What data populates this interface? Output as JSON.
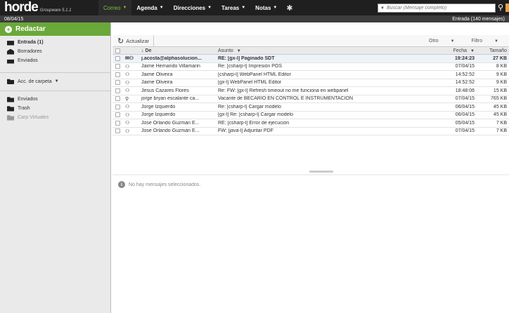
{
  "app": {
    "logo": "horde",
    "logo_sub": "Groupware 5.1.1"
  },
  "menu": [
    {
      "label": "Correo"
    },
    {
      "label": "Agenda"
    },
    {
      "label": "Direcciones"
    },
    {
      "label": "Tareas"
    },
    {
      "label": "Notas"
    }
  ],
  "search": {
    "placeholder": "Buscar (Mensaje completo)"
  },
  "subbar": {
    "date": "08/04/15",
    "mailbox_status": "Entrada (140 mensajes)"
  },
  "sidebar": {
    "compose_label": "Redactar",
    "folders": [
      {
        "label": "Entrada (1)"
      },
      {
        "label": "Borradores"
      },
      {
        "label": "Enviados"
      }
    ],
    "folder_actions_label": "Acc. de carpeta",
    "local_folders": [
      {
        "label": "Enviados"
      },
      {
        "label": "Trash"
      },
      {
        "label": "Carp Virtuales"
      }
    ]
  },
  "toolbar": {
    "refresh_label": "Actualizar",
    "other_label": "Otro",
    "filter_label": "Filtro"
  },
  "columns": {
    "from": "De",
    "subject": "Asunto",
    "date": "Fecha",
    "size": "Tamaño"
  },
  "messages": [
    {
      "icons": "✉ ⚇",
      "from": "j.acosta@alphasolucion...",
      "subject": "RE: [gx-l] Paginado SDT",
      "date": "19:24:23",
      "size": "27 KB",
      "unread": true
    },
    {
      "icons": "⚇",
      "from": "Jaime Hernando Villamarin",
      "subject": "Re: [csharp-l] Impresión POS",
      "date": "07/04/15",
      "size": "8 KB",
      "unread": false
    },
    {
      "icons": "⚇",
      "from": "Jaime Oliveira",
      "subject": "[csharp-l] WebPanel HTML Editor",
      "date": "14:52:52",
      "size": "9 KB",
      "unread": false
    },
    {
      "icons": "⚇",
      "from": "Jaime Oliveira",
      "subject": "[gx-l] WebPanel HTML Editor",
      "date": "14:52:52",
      "size": "9 KB",
      "unread": false
    },
    {
      "icons": "⚇",
      "from": "Jesus Cazares Flores",
      "subject": "Re: FW: [gx-l] Refresh timeout no me funciona en webpanel",
      "date": "18:48:06",
      "size": "15 KB",
      "unread": false
    },
    {
      "icons": "⚲",
      "from": "jorge bryan escalante ca...",
      "subject": "Vacante de BECARIO EN CONTROL E INSTRUMENTACIÓN",
      "date": "07/04/15",
      "size": "765 KB",
      "unread": false
    },
    {
      "icons": "⚇",
      "from": "Jorge Izquierdo",
      "subject": "Re: [csharp-l] Cargar modelo",
      "date": "06/04/15",
      "size": "45 KB",
      "unread": false
    },
    {
      "icons": "⚇",
      "from": "Jorge Izquierdo",
      "subject": "[gx-l] Re: [csharp-l] Cargar modelo",
      "date": "06/04/15",
      "size": "45 KB",
      "unread": false
    },
    {
      "icons": "⚇",
      "from": "Jose Orlando Guzmán E...",
      "subject": "RE: [csharp-l] Error de ejecución",
      "date": "05/04/15",
      "size": "7 KB",
      "unread": false
    },
    {
      "icons": "⚇",
      "from": "Jose Orlando Guzmán E...",
      "subject": "FW: [java-l] Adjuntar PDF",
      "date": "07/04/15",
      "size": "7 KB",
      "unread": false
    }
  ],
  "preview": {
    "empty_text": "No hay mensajes seleccionados."
  }
}
